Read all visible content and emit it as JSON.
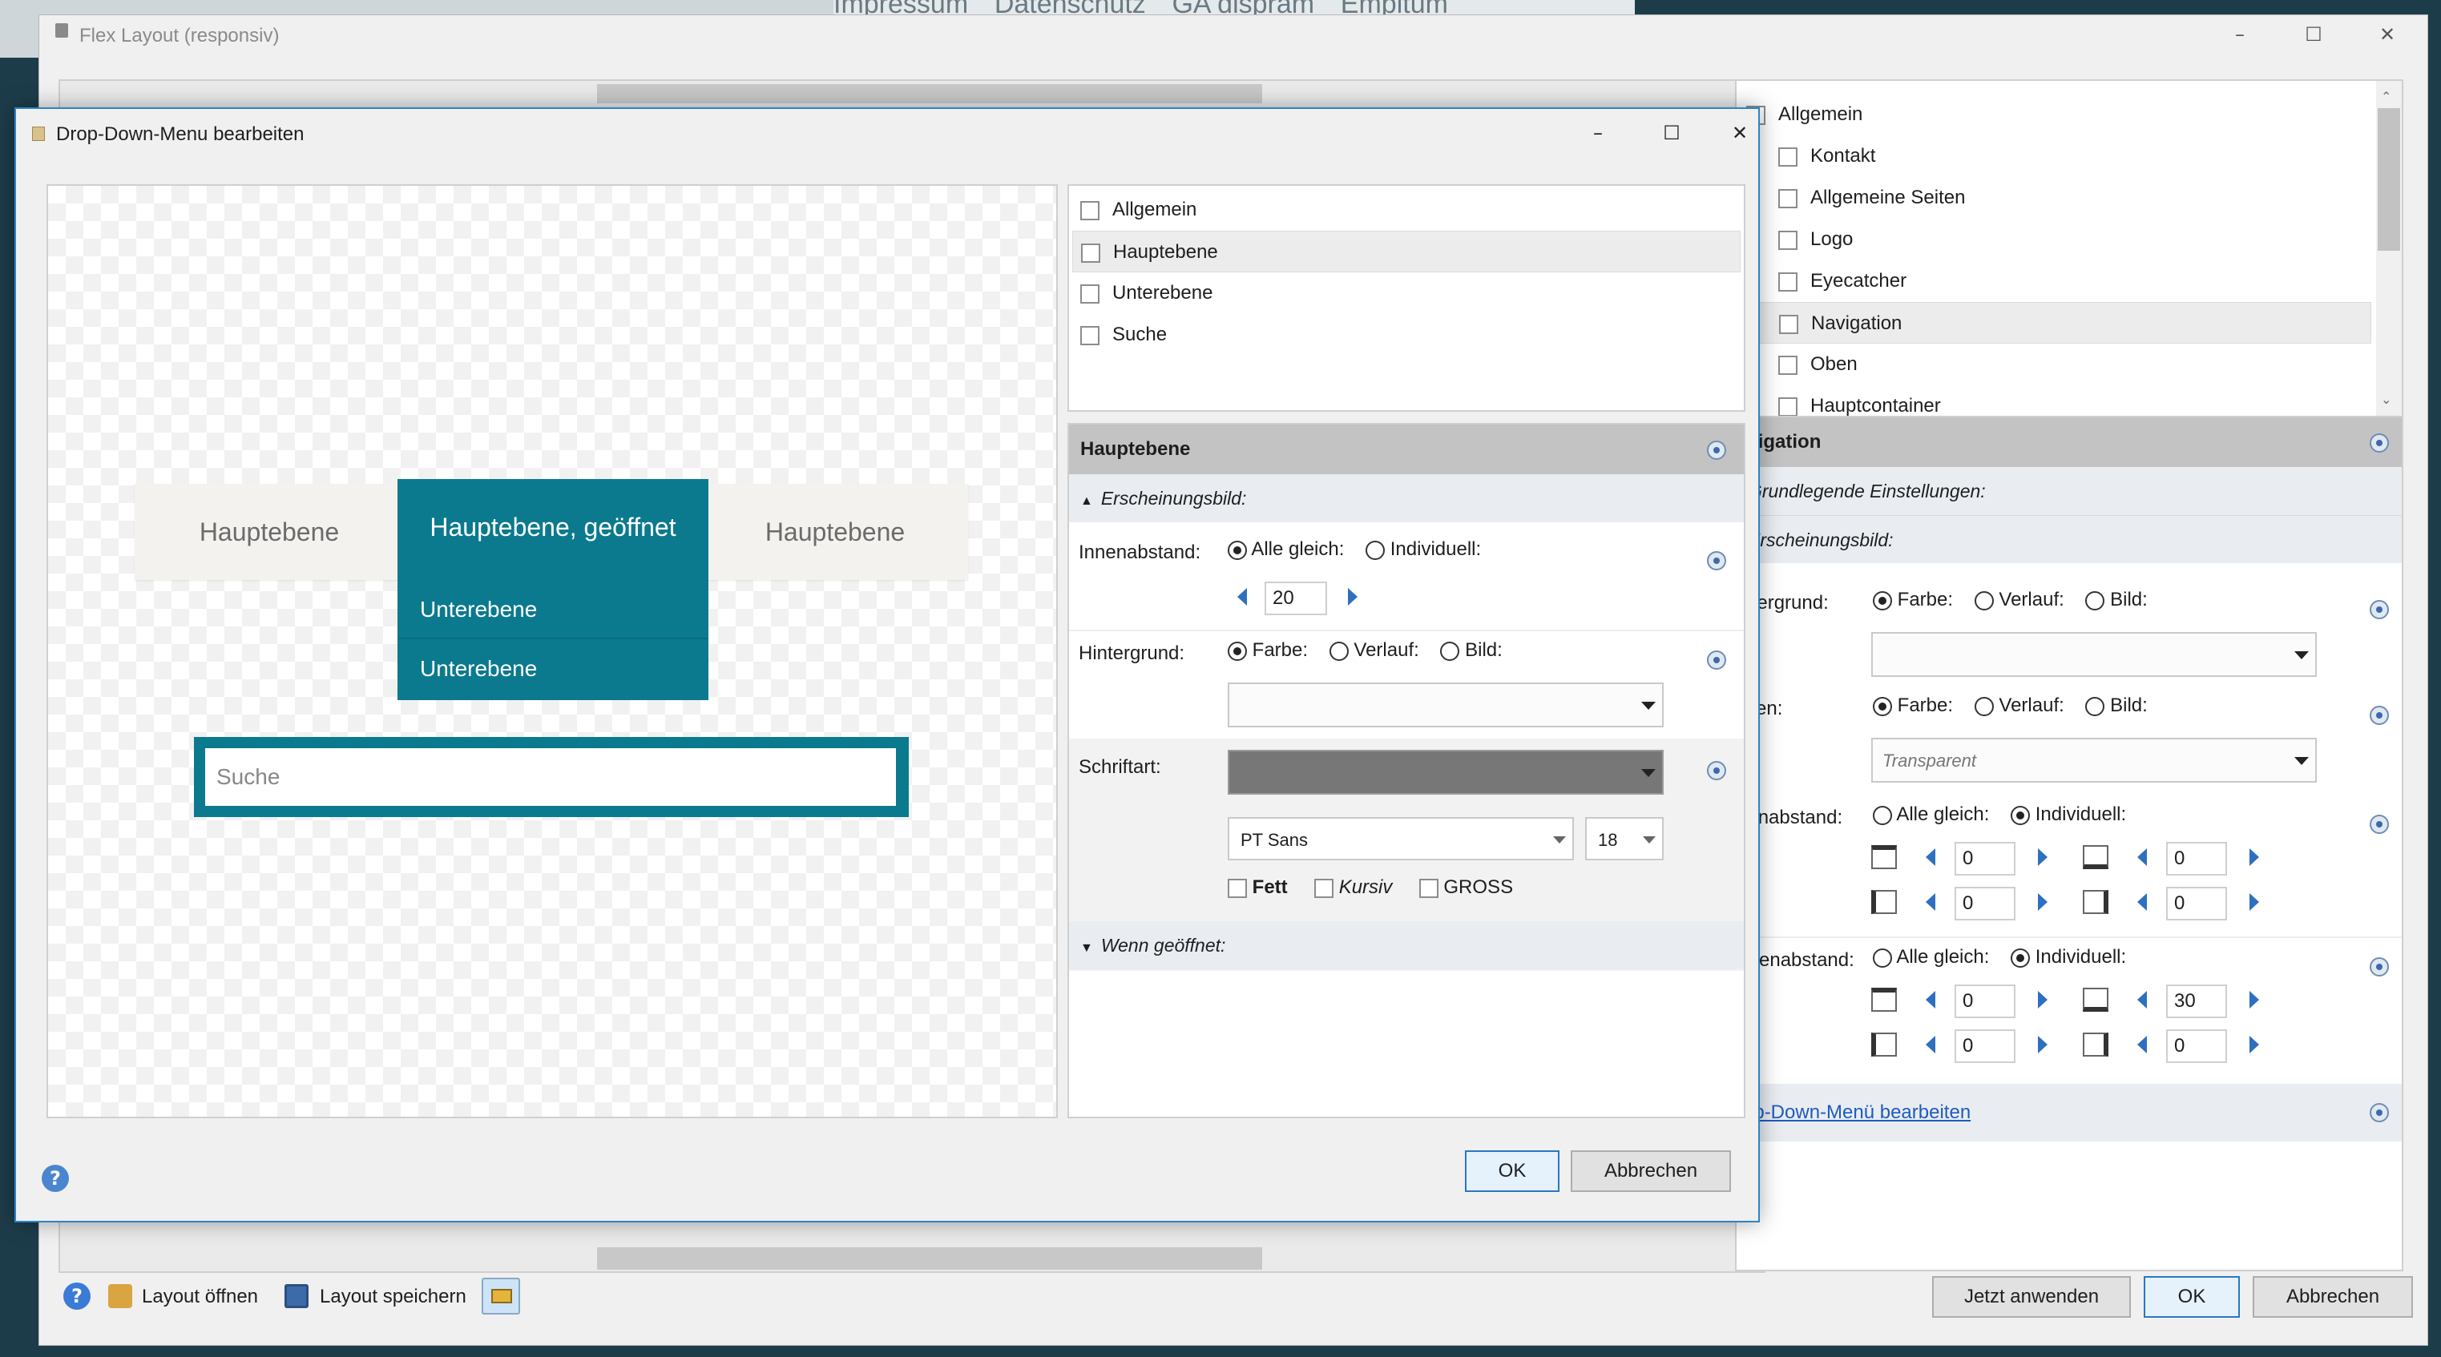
{
  "background": {
    "top_links": [
      "Impressum",
      "Datenschutz",
      "GA dispram",
      "Empitum"
    ]
  },
  "main_window": {
    "title": "Flex Layout (responsiv)",
    "tree": [
      "Allgemein",
      "Kontakt",
      "Allgemeine Seiten",
      "Logo",
      "Eyecatcher",
      "Navigation",
      "Oben",
      "Hauptcontainer"
    ],
    "selected_tree_item": "Navigation",
    "section_title": "avigation",
    "sub_grund": "Grundlegende Einstellungen:",
    "sub_erscheinung": "Erscheinungsbild:",
    "hintergrund_label": "intergrund:",
    "fuellen_label": "üllen:",
    "innen_label": "nenabstand:",
    "aussen_label": "ußenabstand:",
    "opt_farbe": "Farbe:",
    "opt_verlauf": "Verlauf:",
    "opt_bild": "Bild:",
    "opt_alle": "Alle gleich:",
    "opt_indiv": "Individuell:",
    "fuellen_value": "Transparent",
    "innen_values": [
      "0",
      "0",
      "0",
      "0"
    ],
    "aussen_values": [
      "0",
      "30",
      "0",
      "0"
    ],
    "dd_link": "rop-Down-Menü bearbeiten",
    "footer": {
      "open_label": "Layout öffnen",
      "save_label": "Layout speichern",
      "apply_label": "Jetzt anwenden",
      "ok_label": "OK",
      "cancel_label": "Abbrechen"
    }
  },
  "dialog": {
    "title": "Drop-Down-Menu bearbeiten",
    "preview": {
      "nav_items": [
        "Hauptebene",
        "Hauptebene, geöffnet",
        "Hauptebene"
      ],
      "sub_items": [
        "Unterebene",
        "Unterebene"
      ],
      "search_placeholder": "Suche"
    },
    "tree": [
      "Allgemein",
      "Hauptebene",
      "Unterebene",
      "Suche"
    ],
    "selected_tree_item": "Hauptebene",
    "section_title": "Hauptebene",
    "erscheinung": "Erscheinungsbild:",
    "innen_label": "Innenabstand:",
    "opt_alle": "Alle gleich:",
    "opt_indiv": "Individuell:",
    "innen_value": "20",
    "hintergrund_label": "Hintergrund:",
    "opt_farbe": "Farbe:",
    "opt_verlauf": "Verlauf:",
    "opt_bild": "Bild:",
    "schrift_label": "Schriftart:",
    "font_family": "PT Sans",
    "font_size": "18",
    "fett": "Fett",
    "kursiv": "Kursiv",
    "gross": "GROSS",
    "wenn": "Wenn geöffnet:",
    "ok_label": "OK",
    "cancel_label": "Abbrechen"
  },
  "colors": {
    "teal": "#0b7a8e",
    "nav_bg": "#f4f2ee",
    "font_color_swatch": "#777777"
  }
}
